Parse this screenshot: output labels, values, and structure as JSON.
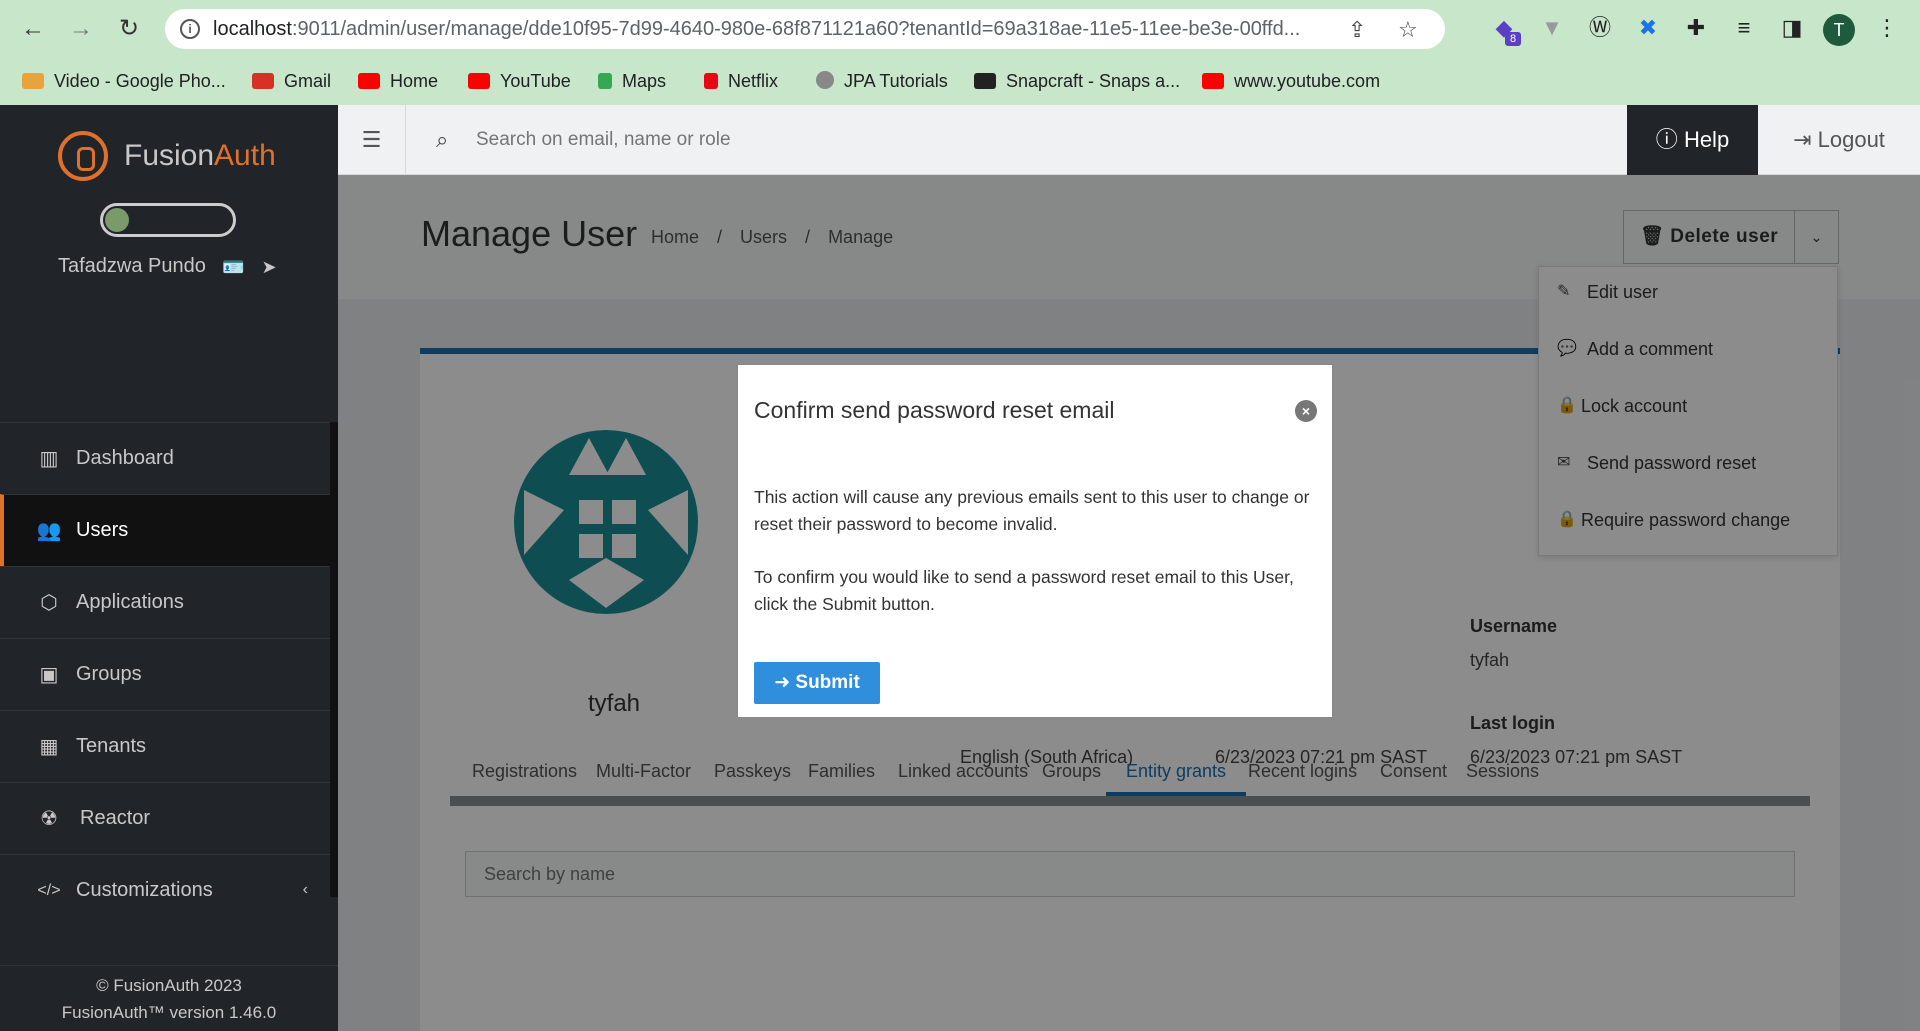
{
  "browser": {
    "url_host": "localhost",
    "url_path": ":9011/admin/user/manage/dde10f95-7d99-4640-980e-68f871121a60?tenantId=69a318ae-11e5-11ee-be3e-00ffd...",
    "profile_initial": "T",
    "extension_badge": "8",
    "bookmarks": [
      {
        "label": "Video - Google Pho...",
        "color": "#e8a33d"
      },
      {
        "label": "Gmail",
        "color": "#d93025"
      },
      {
        "label": "Home",
        "color": "#ff0000"
      },
      {
        "label": "YouTube",
        "color": "#ff0000"
      },
      {
        "label": "Maps",
        "color": "#34a853"
      },
      {
        "label": "Netflix",
        "color": "#e50914"
      },
      {
        "label": "JPA Tutorials",
        "color": "#888888"
      },
      {
        "label": "Snapcraft - Snaps a...",
        "color": "#222222"
      },
      {
        "label": "www.youtube.com",
        "color": "#ff0000"
      }
    ]
  },
  "sidebar": {
    "brand_first": "Fusion",
    "brand_second": "Auth",
    "user_name": "Tafadzwa Pundo",
    "items": [
      {
        "label": "Dashboard",
        "icon": "▥"
      },
      {
        "label": "Users",
        "icon": "👥"
      },
      {
        "label": "Applications",
        "icon": "⬡"
      },
      {
        "label": "Groups",
        "icon": "▣"
      },
      {
        "label": "Tenants",
        "icon": "▦"
      },
      {
        "label": "Reactor",
        "icon": "☢"
      },
      {
        "label": "Customizations",
        "icon": "</>"
      }
    ],
    "footer_line1": "© FusionAuth 2023",
    "footer_line2": "FusionAuth™ version 1.46.0"
  },
  "topbar": {
    "search_placeholder": "Search on email, name or role",
    "help_label": "Help",
    "logout_label": "Logout"
  },
  "page": {
    "title": "Manage User",
    "breadcrumb": [
      "Home",
      "Users",
      "Manage"
    ],
    "delete_label": "Delete user"
  },
  "dropdown": {
    "items": [
      {
        "label": "Edit user",
        "icon": "✎"
      },
      {
        "label": "Add a comment",
        "icon": "💬"
      },
      {
        "label": "Lock account",
        "icon": "🔒"
      },
      {
        "label": "Send password reset",
        "icon": "✉"
      },
      {
        "label": "Require password change",
        "icon": "🔒"
      }
    ]
  },
  "profile": {
    "username_display": "tyfah",
    "fields": {
      "language_value": "English (South Africa)",
      "created_value": "6/23/2023 07:21 pm SAST",
      "username_label": "Username",
      "username_value": "tyfah",
      "last_login_label": "Last login",
      "last_login_value": "6/23/2023 07:21 pm SAST"
    }
  },
  "tabs": [
    "Registrations",
    "Multi-Factor",
    "Passkeys",
    "Families",
    "Linked accounts",
    "Groups",
    "Entity grants",
    "Recent logins",
    "Consent",
    "Sessions"
  ],
  "entity_search_placeholder": "Search by name",
  "modal": {
    "title": "Confirm send password reset email",
    "p1": "This action will cause any previous emails sent to this user to change or reset their password to become invalid.",
    "p2": "To confirm you would like to send a password reset email to this User, click the Submit button.",
    "submit_label": "Submit"
  }
}
